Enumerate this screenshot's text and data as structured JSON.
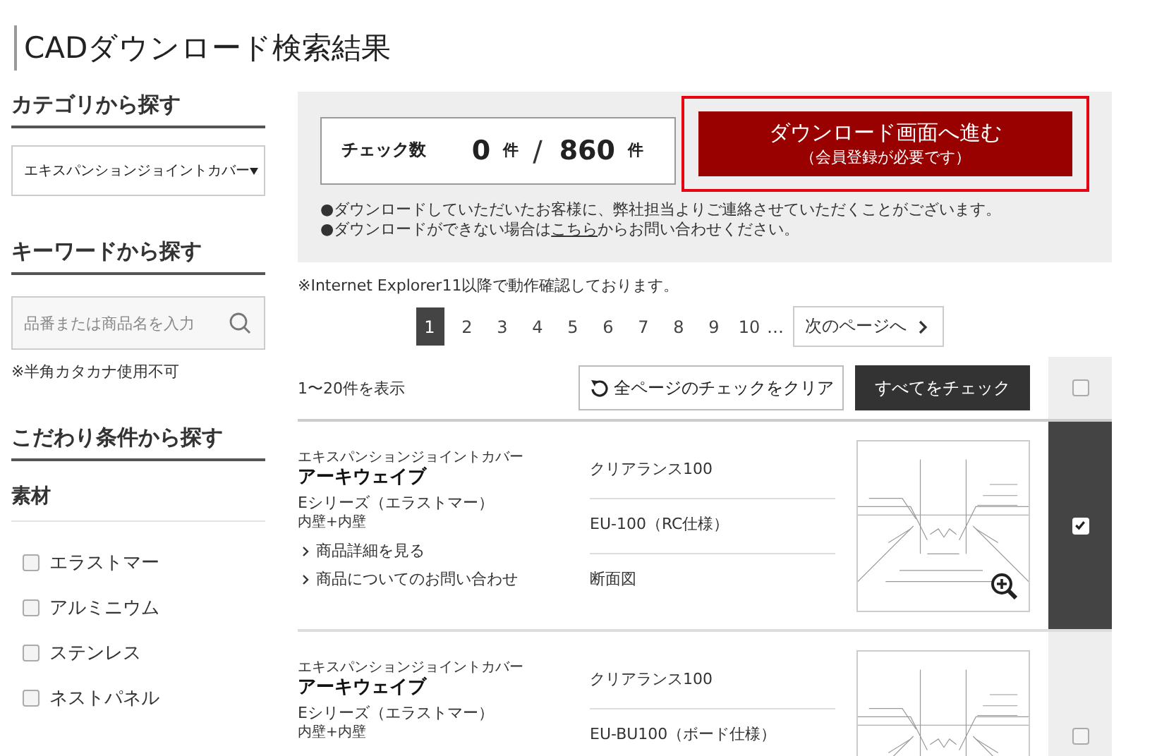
{
  "page_title": "CADダウンロード検索結果",
  "sidebar": {
    "category": {
      "heading": "カテゴリから探す",
      "select_value": "エキスパンションジョイントカバー"
    },
    "keyword": {
      "heading": "キーワードから探す",
      "placeholder": "品番または商品名を入力",
      "note": "※半角カタカナ使用不可"
    },
    "conditions": {
      "heading": "こだわり条件から探す",
      "groups": [
        {
          "heading": "素材",
          "options": [
            {
              "label": "エラストマー",
              "checked": false
            },
            {
              "label": "アルミニウム",
              "checked": false
            },
            {
              "label": "ステンレス",
              "checked": false
            },
            {
              "label": "ネストパネル",
              "checked": false
            }
          ]
        }
      ]
    }
  },
  "download_panel": {
    "count_label": "チェック数",
    "checked_count": "0",
    "unit_1": "件",
    "separator": "/",
    "total": "860",
    "unit_2": "件",
    "button_title": "ダウンロード画面へ進む",
    "button_subtitle": "（会員登録が必要です）",
    "notes": [
      {
        "text": "●ダウンロードしていただいたお客様に、弊社担当よりご連絡させていただくことがございます。"
      },
      {
        "text": "●ダウンロードができない場合は",
        "link": "こちら",
        "after": "からお問い合わせください。"
      }
    ]
  },
  "browser_note": "※Internet Explorer11以降で動作確認しております。",
  "pagination": {
    "pages": [
      {
        "label": "1",
        "selected": true
      },
      {
        "label": "2",
        "selected": false
      },
      {
        "label": "3",
        "selected": false
      },
      {
        "label": "4",
        "selected": false
      },
      {
        "label": "5",
        "selected": false
      },
      {
        "label": "6",
        "selected": false
      },
      {
        "label": "7",
        "selected": false
      },
      {
        "label": "8",
        "selected": false
      },
      {
        "label": "9",
        "selected": false
      },
      {
        "label": "10",
        "selected": false
      }
    ],
    "ellipsis": "…",
    "next": "次のページへ"
  },
  "toolbar": {
    "range": "1〜20件を表示",
    "clear_button": "全ページのチェックをクリア",
    "check_all_button": "すべてをチェック",
    "all_checked": false
  },
  "products": [
    {
      "category": "エキスパンションジョイントカバー",
      "name": "アーキウェイブ",
      "series": "Eシリーズ（エラストマー）",
      "spec": "内壁+内壁",
      "links": [
        "商品詳細を見る",
        "商品についてのお問い合わせ"
      ],
      "attributes": [
        "クリアランス100",
        "EU-100（RC仕様）",
        "断面図"
      ],
      "zoom_icon": true,
      "checked": true
    },
    {
      "category": "エキスパンションジョイントカバー",
      "name": "アーキウェイブ",
      "series": "Eシリーズ（エラストマー）",
      "spec": "内壁+内壁",
      "attributes": [
        "クリアランス100",
        "EU-BU100（ボード仕様）"
      ],
      "checked": false
    }
  ]
}
